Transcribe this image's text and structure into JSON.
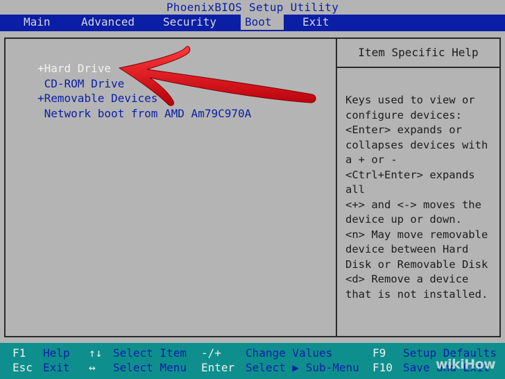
{
  "title": "PhoenixBIOS Setup Utility",
  "tabs": [
    {
      "label": "Main"
    },
    {
      "label": "Advanced"
    },
    {
      "label": "Security"
    },
    {
      "label": "Boot",
      "active": true
    },
    {
      "label": "Exit"
    }
  ],
  "boot": {
    "items": [
      {
        "label": "+Hard Drive",
        "selected": true
      },
      {
        "label": " CD-ROM Drive"
      },
      {
        "label": "+Removable Devices"
      },
      {
        "label": " Network boot from AMD Am79C970A"
      }
    ]
  },
  "help": {
    "title": "Item Specific Help",
    "lines": [
      "Keys used to view or",
      "configure devices:",
      "<Enter> expands or",
      "collapses devices with",
      "a + or -",
      "<Ctrl+Enter> expands",
      "all",
      "<+> and <-> moves the",
      "device up or down.",
      "<n> May move removable",
      "device between Hard",
      "Disk or Removable Disk",
      "<d> Remove a device",
      "that is not installed."
    ]
  },
  "footer": {
    "row1": [
      {
        "key": "F1",
        "desc": "Help"
      },
      {
        "key": "↑↓",
        "desc": "Select Item"
      },
      {
        "key": "-/+",
        "desc": "Change Values"
      },
      {
        "key": "F9",
        "desc": "Setup Defaults"
      }
    ],
    "row2": [
      {
        "key": "Esc",
        "desc": "Exit"
      },
      {
        "key": "↔",
        "desc": "Select Menu"
      },
      {
        "key": "Enter",
        "desc": "Select ▶ Sub-Menu"
      },
      {
        "key": "F10",
        "desc": "Save and Exit"
      }
    ]
  },
  "watermark": "wikiHow",
  "colors": {
    "background": "#b4b4b4",
    "menubar": "#0b1ea6",
    "footer": "#0e8f8d",
    "arrow": "#e0121a",
    "selected_text": "#f2f2f2"
  }
}
